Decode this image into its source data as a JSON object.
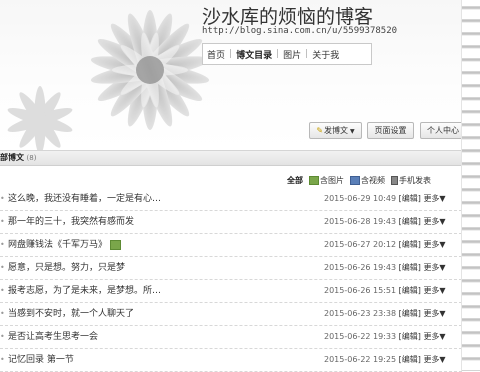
{
  "header": {
    "blog_title": "沙水库的烦恼的博客",
    "blog_url": "http://blog.sina.com.cn/u/5599378520",
    "nav": [
      {
        "label": "首页",
        "current": false
      },
      {
        "label": "博文目录",
        "current": true
      },
      {
        "label": "图片",
        "current": false
      },
      {
        "label": "关于我",
        "current": false
      }
    ],
    "actions": {
      "post_label": "发博文",
      "settings_label": "页面设置",
      "center_label": "个人中心"
    }
  },
  "section": {
    "title": "部博文",
    "count": "(8)"
  },
  "filters": {
    "all": "全部",
    "images": "含图片",
    "videos": "含视频",
    "mobile": "手机发表"
  },
  "posts": [
    {
      "title": "这么晚，我还没有睡着，一定是有心…",
      "date": "2015-06-29 10:49",
      "edit": "[编辑]",
      "more": "更多▼",
      "has_image": false
    },
    {
      "title": "那一年的三十，我突然有感而发",
      "date": "2015-06-28 19:43",
      "edit": "[编辑]",
      "more": "更多▼",
      "has_image": false
    },
    {
      "title": "网盘赚钱法《千军万马》",
      "date": "2015-06-27 20:12",
      "edit": "[编辑]",
      "more": "更多▼",
      "has_image": true
    },
    {
      "title": "愿意，只是想。努力，只是梦",
      "date": "2015-06-26 19:43",
      "edit": "[编辑]",
      "more": "更多▼",
      "has_image": false
    },
    {
      "title": "报考志愿，为了是未来，是梦想。所…",
      "date": "2015-06-26 15:51",
      "edit": "[编辑]",
      "more": "更多▼",
      "has_image": false
    },
    {
      "title": "当感到不安时，就一个人聊天了",
      "date": "2015-06-23 23:38",
      "edit": "[编辑]",
      "more": "更多▼",
      "has_image": false
    },
    {
      "title": "是否让高考生思考一会",
      "date": "2015-06-22 19:33",
      "edit": "[编辑]",
      "more": "更多▼",
      "has_image": false
    },
    {
      "title": "记忆回录 第一节",
      "date": "2015-06-22 19:25",
      "edit": "[编辑]",
      "more": "更多▼",
      "has_image": false
    }
  ]
}
